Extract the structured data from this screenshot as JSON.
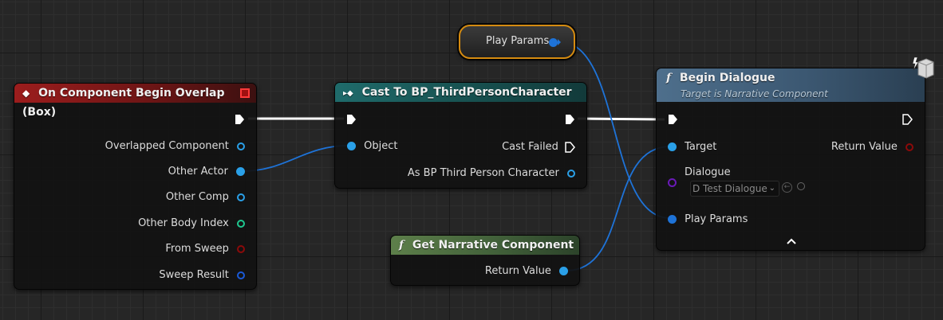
{
  "nodes": {
    "overlap": {
      "title": "On Component Begin Overlap (Box)",
      "pins": {
        "overlapped_component": "Overlapped Component",
        "other_actor": "Other Actor",
        "other_comp": "Other Comp",
        "other_body_index": "Other Body Index",
        "from_sweep": "From Sweep",
        "sweep_result": "Sweep Result"
      }
    },
    "cast": {
      "title": "Cast To BP_ThirdPersonCharacter",
      "pins": {
        "object": "Object",
        "cast_failed": "Cast Failed",
        "as_bp": "As BP Third Person Character"
      }
    },
    "play_params": {
      "label": "Play Params"
    },
    "get_narrative": {
      "title": "Get Narrative Component",
      "pins": {
        "return_value": "Return Value"
      }
    },
    "begin_dialogue": {
      "title": "Begin Dialogue",
      "subtitle": "Target is Narrative Component",
      "pins": {
        "target": "Target",
        "return_value": "Return Value",
        "dialogue": "Dialogue",
        "dialogue_value": "D Test Dialogue",
        "play_params": "Play Params"
      }
    }
  },
  "colors": {
    "object_pin": "#00a8f0",
    "struct_pin": "#0057c8",
    "int_pin": "#1fe0a0",
    "bool_pin": "#950000",
    "class_pin": "#6010b0",
    "exec": "#ffffff",
    "wire_blue": "#1e73d8"
  },
  "icons": {
    "event": "event-diamond-icon",
    "cast": "cast-arrows-icon",
    "function": "function-f-icon",
    "expand": "chevron-up-icon",
    "browse": "arrow-left-circle-icon",
    "search": "search-icon",
    "latent": "latent-cube-icon"
  }
}
